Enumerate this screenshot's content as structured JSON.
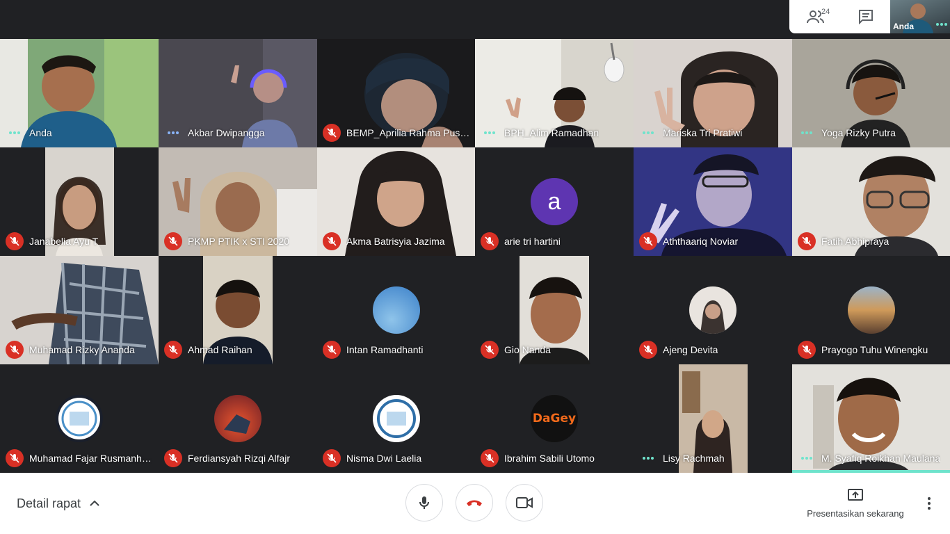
{
  "header": {
    "participant_count": "24",
    "people_icon": "people-icon",
    "chat_icon": "chat-icon",
    "self_label": "Anda"
  },
  "participants": [
    {
      "name": "Anda",
      "muted": false,
      "kind": "video"
    },
    {
      "name": "Akbar Dwipangga",
      "muted": false,
      "kind": "video"
    },
    {
      "name": "BEMP_Aprilia Rahma Puspita",
      "muted": true,
      "kind": "video"
    },
    {
      "name": "BPH_Alim Ramadhan",
      "muted": false,
      "kind": "video"
    },
    {
      "name": "Mariska Tri Pratiwi",
      "muted": false,
      "kind": "video"
    },
    {
      "name": "Yoga Rizky Putra",
      "muted": false,
      "kind": "video"
    },
    {
      "name": "Janabelia Ayu T",
      "muted": true,
      "kind": "video"
    },
    {
      "name": "PKMP PTIK x STI 2020",
      "muted": true,
      "kind": "video"
    },
    {
      "name": "Akma Batrisyia Jazima",
      "muted": true,
      "kind": "video"
    },
    {
      "name": "arie tri hartini",
      "muted": true,
      "kind": "letter",
      "letter": "a"
    },
    {
      "name": "Aththaariq Noviar",
      "muted": true,
      "kind": "video"
    },
    {
      "name": "Fatih Abhipraya",
      "muted": true,
      "kind": "video"
    },
    {
      "name": "Muhamad Rizky Ananda",
      "muted": true,
      "kind": "video"
    },
    {
      "name": "Ahmad Raihan",
      "muted": true,
      "kind": "video"
    },
    {
      "name": "Intan Ramadhanti",
      "muted": true,
      "kind": "photo"
    },
    {
      "name": "Gio Nanda",
      "muted": true,
      "kind": "video"
    },
    {
      "name": "Ajeng Devita",
      "muted": true,
      "kind": "photo"
    },
    {
      "name": "Prayogo Tuhu Winengku",
      "muted": true,
      "kind": "photo"
    },
    {
      "name": "Muhamad Fajar Rusmanhadi",
      "muted": true,
      "kind": "photo"
    },
    {
      "name": "Ferdiansyah Rizqi Alfajr",
      "muted": true,
      "kind": "photo"
    },
    {
      "name": "Nisma Dwi Laelia",
      "muted": true,
      "kind": "photo"
    },
    {
      "name": "Ibrahim Sabili Utomo",
      "muted": true,
      "kind": "logo",
      "logo_text": "DaGey"
    },
    {
      "name": "Lisy Rachmah",
      "muted": false,
      "kind": "video"
    },
    {
      "name": "M. Syafiq Roikhan Maulana",
      "muted": false,
      "kind": "video"
    }
  ],
  "footer": {
    "details_label": "Detail rapat",
    "present_label": "Presentasikan sekarang",
    "mic_icon": "microphone-icon",
    "hangup_icon": "hang-up-icon",
    "camera_icon": "camera-icon",
    "more_icon": "more-vert-icon"
  },
  "colors": {
    "background": "#202124",
    "mute_red": "#d93025",
    "speaking_teal": "#6fe3cc",
    "avatar_purple": "#5e35b1"
  }
}
